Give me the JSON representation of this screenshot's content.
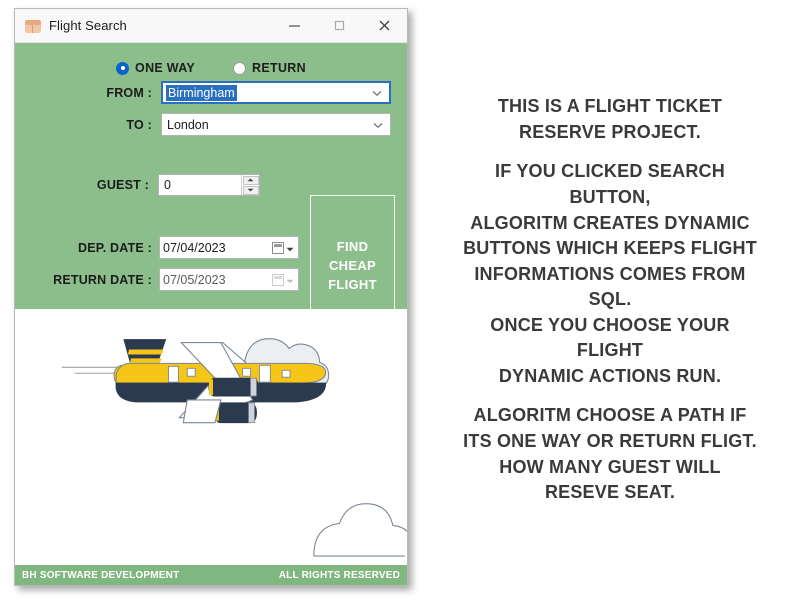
{
  "window": {
    "title": "Flight Search",
    "icon": "app-icon",
    "controls": {
      "minimize": "minimize-icon",
      "maximize": "maximize-icon",
      "close": "close-icon"
    }
  },
  "colors": {
    "panel_green": "#8CBE8C",
    "footer_green": "#80B680",
    "accent_blue": "#2A6EC0",
    "plane_yellow": "#F5C518",
    "plane_navy": "#2B3A4F",
    "text_dark": "#3A3A3A"
  },
  "form": {
    "trip_type": {
      "options": [
        {
          "label": "ONE WAY",
          "checked": true
        },
        {
          "label": "RETURN",
          "checked": false
        }
      ]
    },
    "from": {
      "label": "FROM :",
      "value": "Birmingham",
      "selected": true,
      "focused": true,
      "arrow": "chevron-down-icon"
    },
    "to": {
      "label": "TO :",
      "value": "London",
      "selected": false,
      "focused": false,
      "arrow": "chevron-down-icon"
    },
    "guest": {
      "label": "GUEST :",
      "value": "0",
      "spinner_up": "spinner-up-icon",
      "spinner_down": "spinner-down-icon"
    },
    "dep_date": {
      "label": "DEP. DATE :",
      "value": "07/04/2023",
      "enabled": true,
      "icon": "calendar-icon"
    },
    "return_date": {
      "label": "RETURN DATE :",
      "value": "07/05/2023",
      "enabled": false,
      "icon": "calendar-icon"
    },
    "find_button": {
      "line1": "FIND",
      "line2": "CHEAP",
      "line3": "FLIGHT"
    }
  },
  "illustration": {
    "name": "airplane-illustration"
  },
  "footer": {
    "left": "BH SOFTWARE DEVELOPMENT",
    "right": "ALL RIGHTS RESERVED"
  },
  "description": {
    "lines": [
      "THIS IS A FLIGHT TICKET",
      "RESERVE PROJECT.",
      "",
      "IF YOU CLICKED SEARCH",
      "BUTTON,",
      "ALGORITM CREATES DYNAMIC",
      "BUTTONS WHICH KEEPS FLIGHT",
      "INFORMATIONS COMES FROM",
      "SQL.",
      "ONCE YOU CHOOSE YOUR",
      "FLIGHT",
      "DYNAMIC ACTIONS RUN.",
      "",
      "ALGORITM CHOOSE A PATH IF",
      "ITS ONE WAY OR RETURN FLIGT.",
      "HOW MANY GUEST WILL",
      "RESEVE SEAT."
    ]
  }
}
